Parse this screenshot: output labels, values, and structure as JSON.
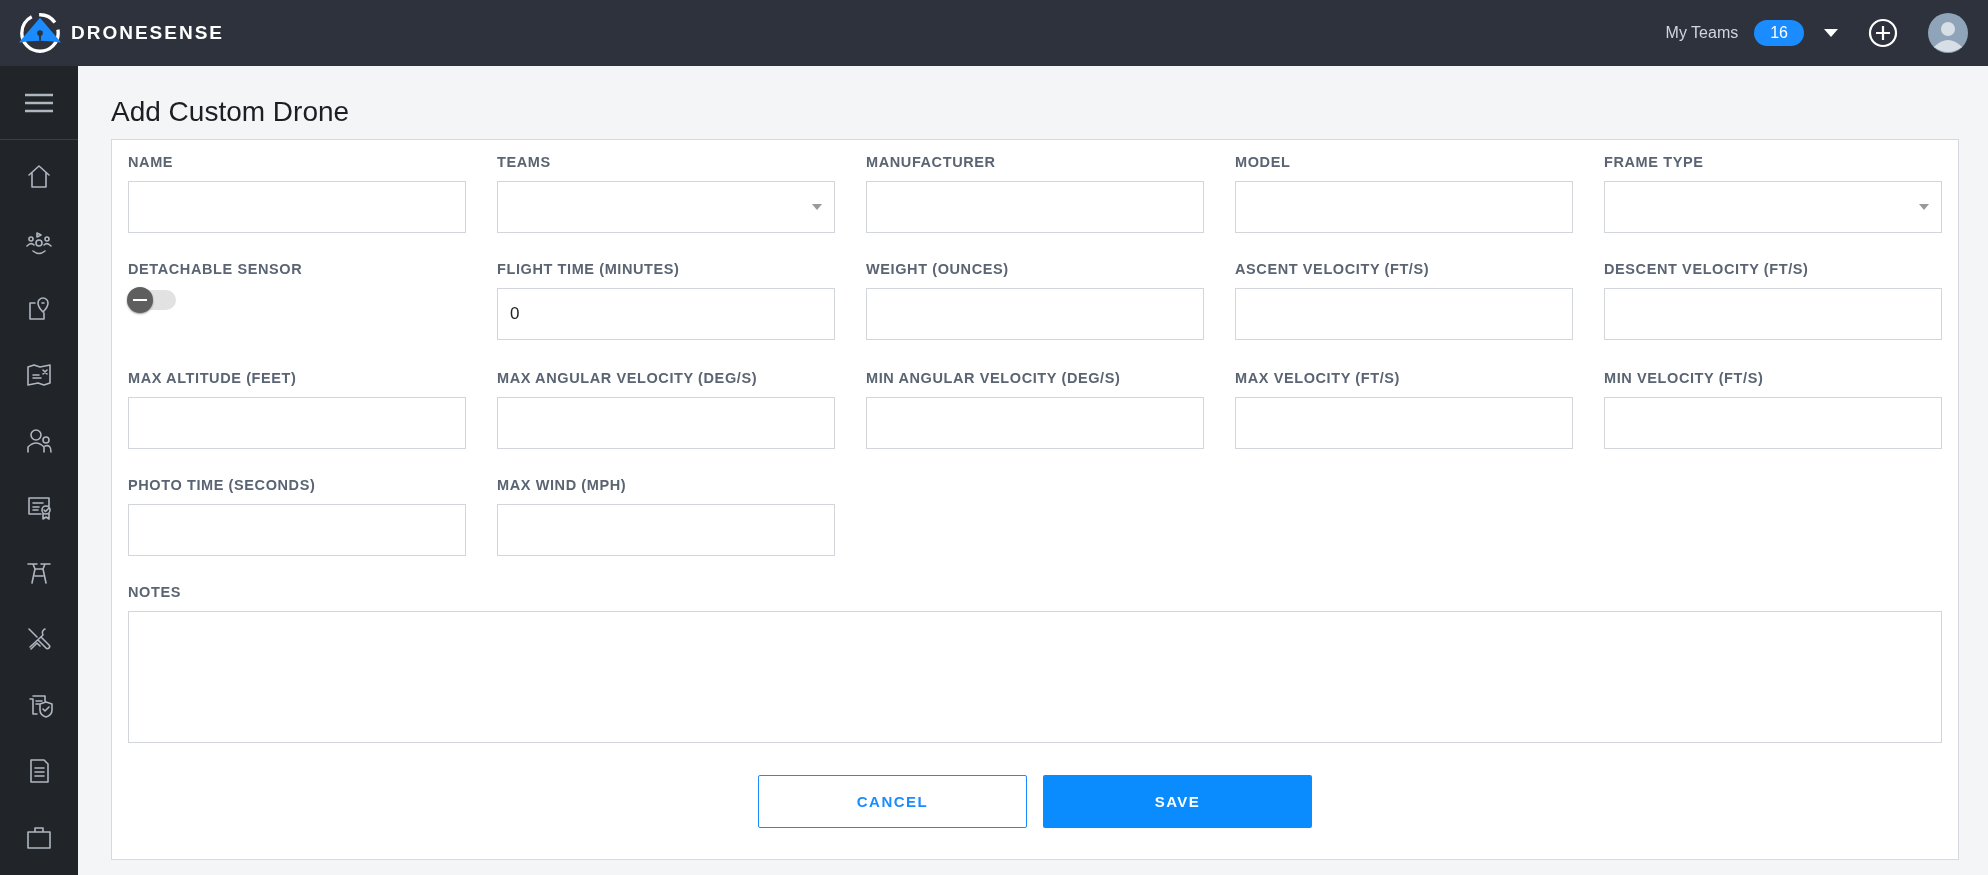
{
  "topbar": {
    "brand": "DRONESENSE",
    "teams_label": "My Teams",
    "teams_count": "16"
  },
  "page": {
    "title": "Add Custom Drone"
  },
  "fields": [
    {
      "label": "NAME",
      "kind": "text"
    },
    {
      "label": "TEAMS",
      "kind": "select"
    },
    {
      "label": "MANUFACTURER",
      "kind": "text"
    },
    {
      "label": "MODEL",
      "kind": "text"
    },
    {
      "label": "FRAME TYPE",
      "kind": "select"
    },
    {
      "label": "DETACHABLE SENSOR",
      "kind": "toggle",
      "on": false
    },
    {
      "label": "FLIGHT TIME (MINUTES)",
      "kind": "text",
      "value": "0"
    },
    {
      "label": "WEIGHT (OUNCES)",
      "kind": "text"
    },
    {
      "label": "ASCENT VELOCITY (FT/S)",
      "kind": "text"
    },
    {
      "label": "DESCENT VELOCITY (FT/S)",
      "kind": "text"
    },
    {
      "label": "MAX ALTITUDE (FEET)",
      "kind": "text"
    },
    {
      "label": "MAX ANGULAR VELOCITY (DEG/S)",
      "kind": "text"
    },
    {
      "label": "MIN ANGULAR VELOCITY (DEG/S)",
      "kind": "text"
    },
    {
      "label": "MAX VELOCITY (FT/S)",
      "kind": "text"
    },
    {
      "label": "MIN VELOCITY (FT/S)",
      "kind": "text"
    },
    {
      "label": "PHOTO TIME (SECONDS)",
      "kind": "text"
    },
    {
      "label": "MAX WIND (MPH)",
      "kind": "text"
    },
    {
      "label": "NOTES",
      "kind": "textarea"
    }
  ],
  "buttons": [
    {
      "label": "CANCEL",
      "kind": "secondary"
    },
    {
      "label": "SAVE",
      "kind": "primary"
    }
  ]
}
